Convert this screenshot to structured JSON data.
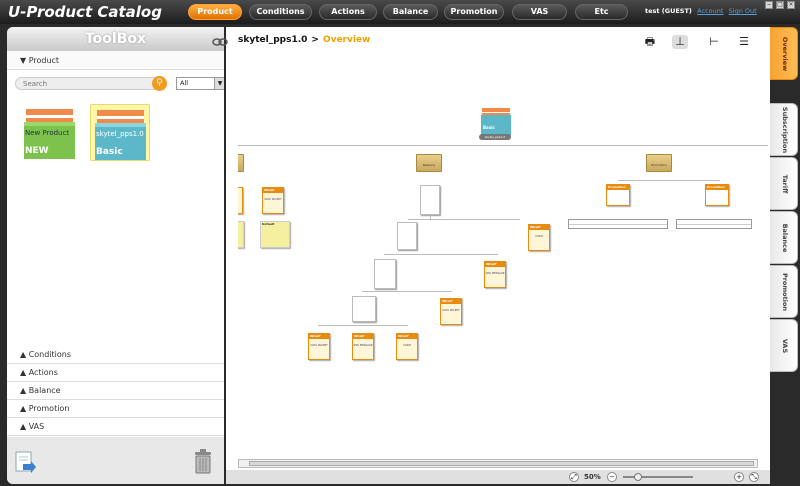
{
  "app": {
    "title": "U-Product Catalog"
  },
  "nav": [
    {
      "label": "Product",
      "active": true
    },
    {
      "label": "Conditions"
    },
    {
      "label": "Actions"
    },
    {
      "label": "Balance"
    },
    {
      "label": "Promotion"
    },
    {
      "label": "VAS"
    },
    {
      "label": "Etc"
    }
  ],
  "user": {
    "name": "test",
    "role": "(GUEST)",
    "account_link": "Account",
    "signout_link": "Sign Out"
  },
  "toolbox": {
    "title": "ToolBox",
    "product_section": "▼ Product",
    "search_placeholder": "Search",
    "filter_value": "All",
    "cards": [
      {
        "label": "New Product",
        "badge": "NEW",
        "color": "#7ec24e"
      },
      {
        "label": "skytel_pps1.0",
        "badge": "Basic",
        "color": "#5cb8c8"
      }
    ],
    "accordion": [
      "▲ Conditions",
      "▲ Actions",
      "▲ Balance",
      "▲ Promotion",
      "▲ VAS"
    ]
  },
  "main": {
    "crumb_root": "skytel_pps1.0",
    "crumb_sep": ">",
    "crumb_current": "Overview",
    "root_node": {
      "title": "Basic",
      "caption": "skytel_pps1.0"
    },
    "folders": [
      "Balance",
      "Promotion"
    ],
    "what_label": "What?",
    "nodes": {
      "default": "Default",
      "voice": "VOICE",
      "sms": "SMS MESSAGE",
      "data": "DATA PACKET",
      "promotion": "Promotion"
    }
  },
  "zoom": {
    "value": "50%",
    "minus": "−",
    "plus": "+"
  },
  "side_tabs": [
    {
      "label": "Overview",
      "active": true
    },
    {
      "label": "Subscription"
    },
    {
      "label": "Tariff"
    },
    {
      "label": "Balance"
    },
    {
      "label": "Promotion"
    },
    {
      "label": "VAS"
    }
  ]
}
